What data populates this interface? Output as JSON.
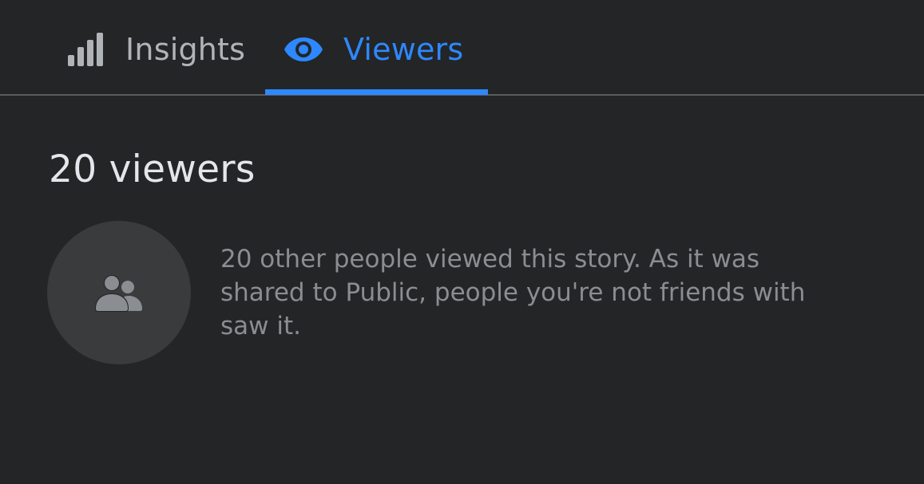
{
  "tabs": {
    "insights": {
      "label": "Insights",
      "icon": "bar-chart-icon",
      "selected": false
    },
    "viewers": {
      "label": "Viewers",
      "icon": "eye-icon",
      "selected": true
    }
  },
  "summary": {
    "heading": "20 viewers",
    "avatar_icon": "people-icon",
    "description": "20 other people viewed this story. As it was shared to Public, people you're not friends with saw it."
  },
  "colors": {
    "background": "#242526",
    "accent": "#2d88ff",
    "primary_text": "#e4e6eb",
    "secondary_text": "#8a8d91",
    "avatar_bg": "#3a3b3c"
  }
}
